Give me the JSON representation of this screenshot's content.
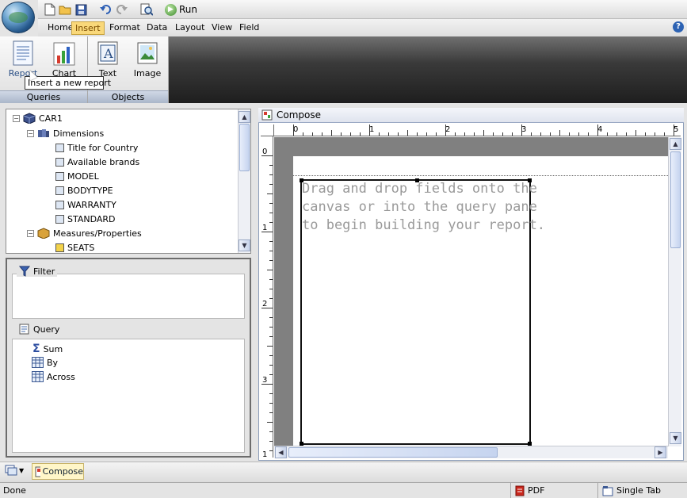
{
  "quick_access": {
    "run_label": "Run",
    "icons": [
      "new-document-icon",
      "open-folder-icon",
      "save-icon",
      "undo-icon",
      "redo-icon",
      "preview-icon"
    ]
  },
  "menu": {
    "items": [
      {
        "label": "Home",
        "active": false
      },
      {
        "label": "Insert",
        "active": true
      },
      {
        "label": "Format",
        "active": false
      },
      {
        "label": "Data",
        "active": false
      },
      {
        "label": "Layout",
        "active": false
      },
      {
        "label": "View",
        "active": false
      },
      {
        "label": "Field",
        "active": false
      }
    ],
    "help_label": "?"
  },
  "ribbon": {
    "groups": [
      {
        "label": "Queries",
        "buttons": [
          {
            "label": "Report",
            "icon": "report-icon"
          },
          {
            "label": "Chart",
            "icon": "chart-icon"
          }
        ]
      },
      {
        "label": "Objects",
        "buttons": [
          {
            "label": "Text",
            "icon": "text-icon"
          },
          {
            "label": "Image",
            "icon": "image-icon"
          }
        ]
      }
    ],
    "tooltip": "Insert a new report"
  },
  "tree": {
    "root": "CAR1",
    "dimensions_label": "Dimensions",
    "dimensions": [
      "Title for Country",
      "Available brands",
      "MODEL",
      "BODYTYPE",
      "WARRANTY",
      "STANDARD"
    ],
    "measures_label": "Measures/Properties",
    "measures": [
      "SEATS"
    ]
  },
  "query_pane": {
    "filter_label": "Filter",
    "query_label": "Query",
    "items": [
      {
        "label": "Sum",
        "icon": "sigma-icon"
      },
      {
        "label": "By",
        "icon": "grid-icon"
      },
      {
        "label": "Across",
        "icon": "grid-icon"
      }
    ]
  },
  "compose": {
    "title": "Compose",
    "ruler_h": [
      "0",
      "1",
      "2",
      "3",
      "4",
      "5"
    ],
    "ruler_v": [
      "0",
      "1",
      "2",
      "3",
      "1"
    ],
    "placeholder": "Drag and drop fields onto the\ncanvas or into the query pane\nto begin building your report."
  },
  "bottom_tabs": {
    "compose_label": "Compose"
  },
  "status": {
    "text": "Done",
    "pdf_label": "PDF",
    "tab_label": "Single Tab"
  },
  "colors": {
    "active_menu": "#f9d87a",
    "ribbon_dark": "#2c2c2c",
    "canvas_gray": "#808080"
  }
}
